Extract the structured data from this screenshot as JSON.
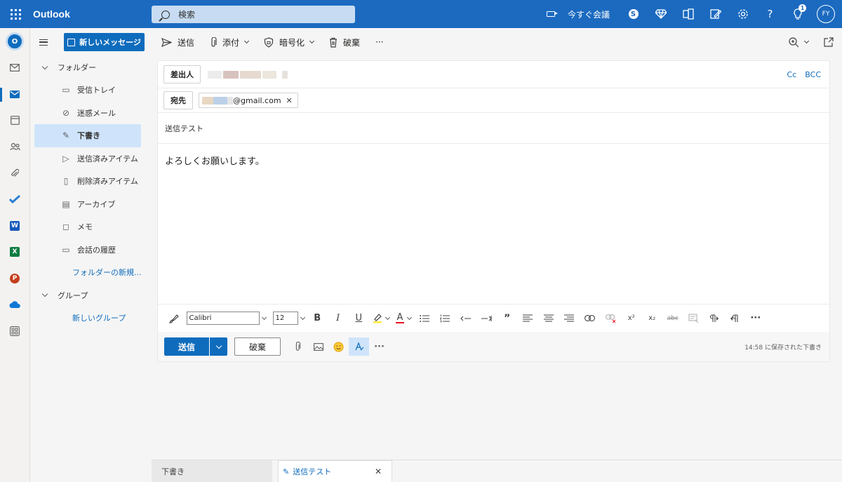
{
  "app": {
    "brand": "Outlook",
    "search_placeholder": "検索",
    "meet_now": "今すぐ会議",
    "skype_letter": "S",
    "badge_count": "1",
    "avatar_initials": "FY",
    "help_symbol": "?"
  },
  "folders": {
    "new_message": "新しいメッセージ",
    "group_folders": "フォルダー",
    "items": [
      {
        "label": "受信トレイ",
        "icon": "inbox-icon"
      },
      {
        "label": "迷惑メール",
        "icon": "junk-icon"
      },
      {
        "label": "下書き",
        "icon": "drafts-icon"
      },
      {
        "label": "送信済みアイテム",
        "icon": "sent-icon"
      },
      {
        "label": "削除済みアイテム",
        "icon": "trash-icon"
      },
      {
        "label": "アーカイブ",
        "icon": "archive-icon"
      },
      {
        "label": "メモ",
        "icon": "note-icon"
      },
      {
        "label": "会話の履歴",
        "icon": "folder-icon"
      }
    ],
    "new_folder": "フォルダーの新規...",
    "group_groups": "グループ",
    "new_group": "新しいグループ"
  },
  "toolbar": {
    "send": "送信",
    "attach": "添付",
    "encrypt": "暗号化",
    "discard": "破棄",
    "more": "···"
  },
  "compose": {
    "from_label": "差出人",
    "to_label": "宛先",
    "cc": "Cc",
    "bcc": "BCC",
    "recipient_suffix": "@gmail.com",
    "subject": "送信テスト",
    "body": "よろしくお願いします。"
  },
  "format": {
    "font": "Calibri",
    "size": "12",
    "bold": "B",
    "italic": "I",
    "underline": "U",
    "font_color_letter": "A",
    "quote": "”",
    "superscript": "x²",
    "subscript": "x₂",
    "strike": "abc",
    "more": "···"
  },
  "actions": {
    "send": "送信",
    "discard": "破棄",
    "more": "···",
    "saved_status": "14:58 に保存された下書き"
  },
  "tabs": {
    "drafts": "下書き",
    "draft_item": "送信テスト"
  },
  "colors": {
    "accent": "#0f6cbd",
    "header": "#1b6ac0",
    "selected": "#cfe4fa"
  }
}
